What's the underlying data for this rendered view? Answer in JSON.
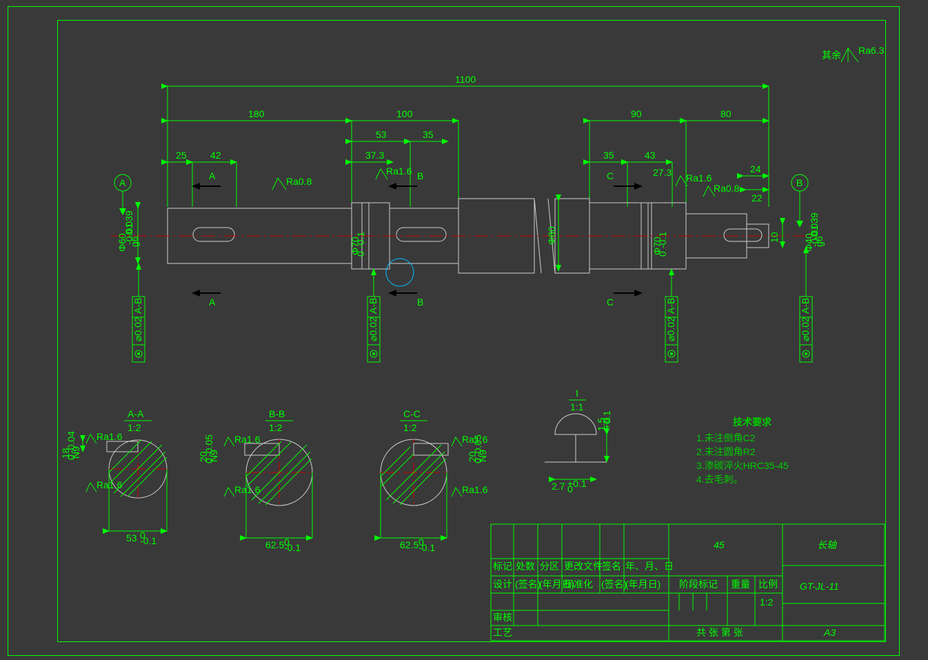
{
  "surface_finish": {
    "prefix": "其余",
    "value": "Ra6.3"
  },
  "main_dims": {
    "overall": "1100",
    "left_sec": "180",
    "mid_sec": "100",
    "right_sec1": "90",
    "right_sec2": "80",
    "d1": "25",
    "d2": "42",
    "d3": "53",
    "d4": "35",
    "d5": "37.3",
    "d6": "35",
    "d7": "43",
    "d8": "27.3",
    "d9": "24",
    "d10": "22",
    "d11": "10",
    "ra08": "Ra0.8",
    "ra16": "Ra1.6",
    "ra08b": "Ra0.8",
    "dia60": "Φ60",
    "tol60": "-0.01\n-0.039",
    "grade60": "g6",
    "dia70": "Φ70",
    "tol70a": "0",
    "tol70b": "-0.1",
    "dia80": "Φ80",
    "dia40": "Φ40",
    "tol40": "-0.01\n-0.039",
    "grade40": "g6",
    "dia_mid": "Φ70",
    "tol_mid": "0\n-0.1",
    "datum_a": "A",
    "datum_b": "B",
    "gtol": "⌀0.02",
    "gtol_ref": "A-B",
    "sec_a": "A",
    "sec_b": "B",
    "sec_c": "C"
  },
  "sections": {
    "aa": {
      "label": "A-A",
      "scale": "1:2",
      "width": "53",
      "wtol": "0\n-0.1",
      "height": "18",
      "htol": "0\n-0.04",
      "grade": "N9",
      "ra": "Ra1.6"
    },
    "bb": {
      "label": "B-B",
      "scale": "1:2",
      "width": "62.5",
      "wtol": "0\n-0.1",
      "height": "20",
      "htol": "0\n-0.05",
      "grade": "N9",
      "ra": "Ra1.6"
    },
    "cc": {
      "label": "C-C",
      "scale": "1:2",
      "width": "62.5",
      "wtol": "0\n-0.1",
      "height": "20",
      "htol": "0\n-0.05",
      "grade": "N9",
      "ra": "Ra1.6"
    },
    "detail_i": {
      "label": "I",
      "scale": "1:1",
      "w": "2.7",
      "wtol": "+0.1\n0",
      "h": "1.5",
      "htol": "+0.1\n0"
    }
  },
  "tech_req": {
    "title": "技术要求",
    "items": [
      "1.未注倒角C2",
      "2.未注圆角R2",
      "3.渗碳淬火HRC35-45",
      "4.去毛刺。"
    ]
  },
  "title_block": {
    "material": "45",
    "part_name": "长轴",
    "drawing_no": "GT-JL-11",
    "size": "A3",
    "scale": "1:2",
    "h1": "标记",
    "h2": "处数",
    "h3": "分区",
    "h4": "更改文件",
    "h5": "签名",
    "h6": "年、月、日",
    "h7": "设计",
    "h8": "(签名)",
    "h9": "(年月日)",
    "h10": "标准化",
    "h11": "(签名)",
    "h12": "(年月日)",
    "h13": "审核",
    "h14": "工艺",
    "h15": "阶段标记",
    "h16": "重量",
    "h17": "比例",
    "sheet": "共  张 第  张"
  }
}
